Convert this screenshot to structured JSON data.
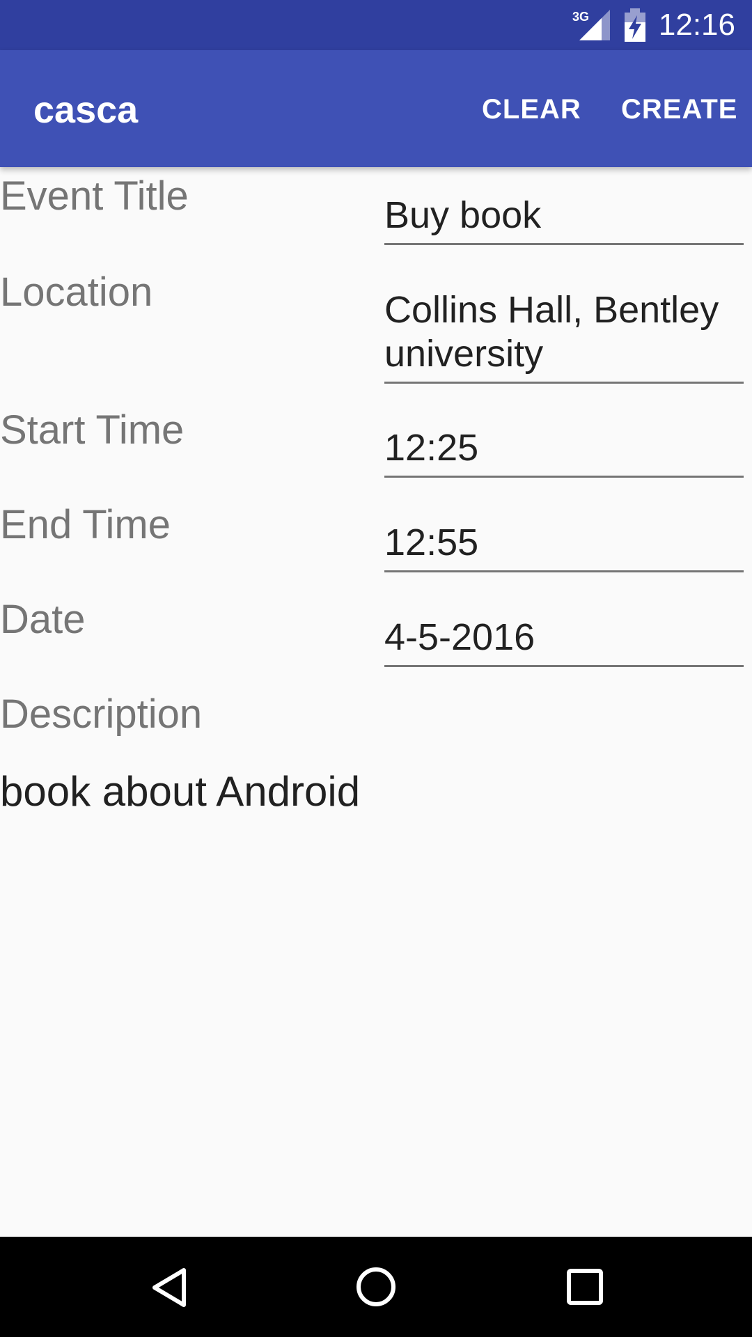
{
  "status_bar": {
    "network": "3G",
    "time": "12:16",
    "icons": [
      "signal-icon",
      "battery-icon"
    ]
  },
  "app_bar": {
    "title": "casca",
    "clear_label": "CLEAR",
    "create_label": "CREATE",
    "color": "#3f51b5",
    "status_color": "#303f9f"
  },
  "form": {
    "event_title": {
      "label": "Event Title",
      "value": "Buy book"
    },
    "location": {
      "label": "Location",
      "value": "Collins Hall, Bentley university"
    },
    "start_time": {
      "label": "Start Time",
      "value": "12:25"
    },
    "end_time": {
      "label": "End Time",
      "value": "12:55"
    },
    "date": {
      "label": "Date",
      "value": "4-5-2016"
    },
    "description": {
      "label": "Description",
      "value": "book about Android"
    }
  },
  "nav_bar": {
    "icons": [
      "back-icon",
      "home-icon",
      "recents-icon"
    ]
  }
}
